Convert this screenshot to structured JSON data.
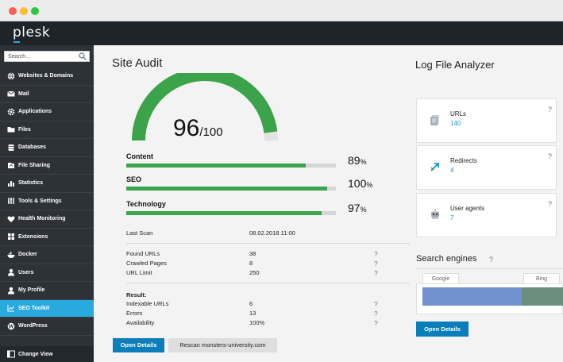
{
  "window": {
    "controls": [
      "close",
      "minimize",
      "maximize"
    ]
  },
  "header": {
    "logo": "plesk"
  },
  "sidebar": {
    "search_placeholder": "Search...",
    "items": [
      {
        "label": "Websites & Domains",
        "icon": "globe-icon"
      },
      {
        "label": "Mail",
        "icon": "mail-icon"
      },
      {
        "label": "Applications",
        "icon": "gear-icon"
      },
      {
        "label": "Files",
        "icon": "folder-icon"
      },
      {
        "label": "Databases",
        "icon": "database-icon"
      },
      {
        "label": "File Sharing",
        "icon": "share-icon"
      },
      {
        "label": "Statistics",
        "icon": "chart-icon"
      },
      {
        "label": "Tools & Settings",
        "icon": "tools-icon"
      },
      {
        "label": "Health Monitoring",
        "icon": "heart-icon"
      },
      {
        "label": "Extensions",
        "icon": "grid-icon"
      },
      {
        "label": "Docker",
        "icon": "docker-icon"
      },
      {
        "label": "Users",
        "icon": "user-icon"
      },
      {
        "label": "My Profile",
        "icon": "profile-icon"
      },
      {
        "label": "SEO Toolkit",
        "icon": "seo-icon",
        "active": true
      },
      {
        "label": "WordPress",
        "icon": "wordpress-icon"
      }
    ],
    "change_view": "Change View"
  },
  "site_audit": {
    "title": "Site Audit",
    "score": "96",
    "score_max": "/100",
    "score_fraction": 0.96,
    "metrics": [
      {
        "label": "Content",
        "value": "89",
        "unit": "%",
        "fraction": 0.89
      },
      {
        "label": "SEO",
        "value": "100",
        "unit": "%",
        "fraction": 1.0
      },
      {
        "label": "Technology",
        "value": "97",
        "unit": "%",
        "fraction": 0.97
      }
    ],
    "last_scan_label": "Last Scan",
    "last_scan_value": "08.02.2018 11:00",
    "stats": [
      {
        "label": "Found URLs",
        "value": "38",
        "help": "?"
      },
      {
        "label": "Crawled Pages",
        "value": "8",
        "help": "?"
      },
      {
        "label": "URL Limit",
        "value": "250",
        "help": "?"
      }
    ],
    "result_label": "Result:",
    "results": [
      {
        "label": "Indexable URLs",
        "value": "6",
        "help": "?"
      },
      {
        "label": "Errors",
        "value": "13",
        "help": "?"
      },
      {
        "label": "Availability",
        "value": "100%",
        "help": "?"
      }
    ],
    "open_details": "Open Details",
    "rescan": "Rescan monsters-university.com"
  },
  "log_file_analyzer": {
    "title": "Log File Analyzer",
    "cards": [
      {
        "name": "URLs",
        "value": "140",
        "help": "?",
        "icon": "document-icon"
      },
      {
        "name": "Redirects",
        "value": "4",
        "help": "?",
        "icon": "redirect-icon"
      },
      {
        "name": "User agents",
        "value": "7",
        "help": "?",
        "icon": "robot-icon"
      }
    ],
    "search_engines_title": "Search engines",
    "search_engines_help": "?",
    "engines": [
      "Google",
      "Bing"
    ],
    "open_details": "Open Details"
  },
  "colors": {
    "accent": "#28aadf",
    "button": "#0a7dbb",
    "gauge_fill": "#3ba34a",
    "google_bar": "#7291cf",
    "bing_bar": "#6a8f80"
  }
}
